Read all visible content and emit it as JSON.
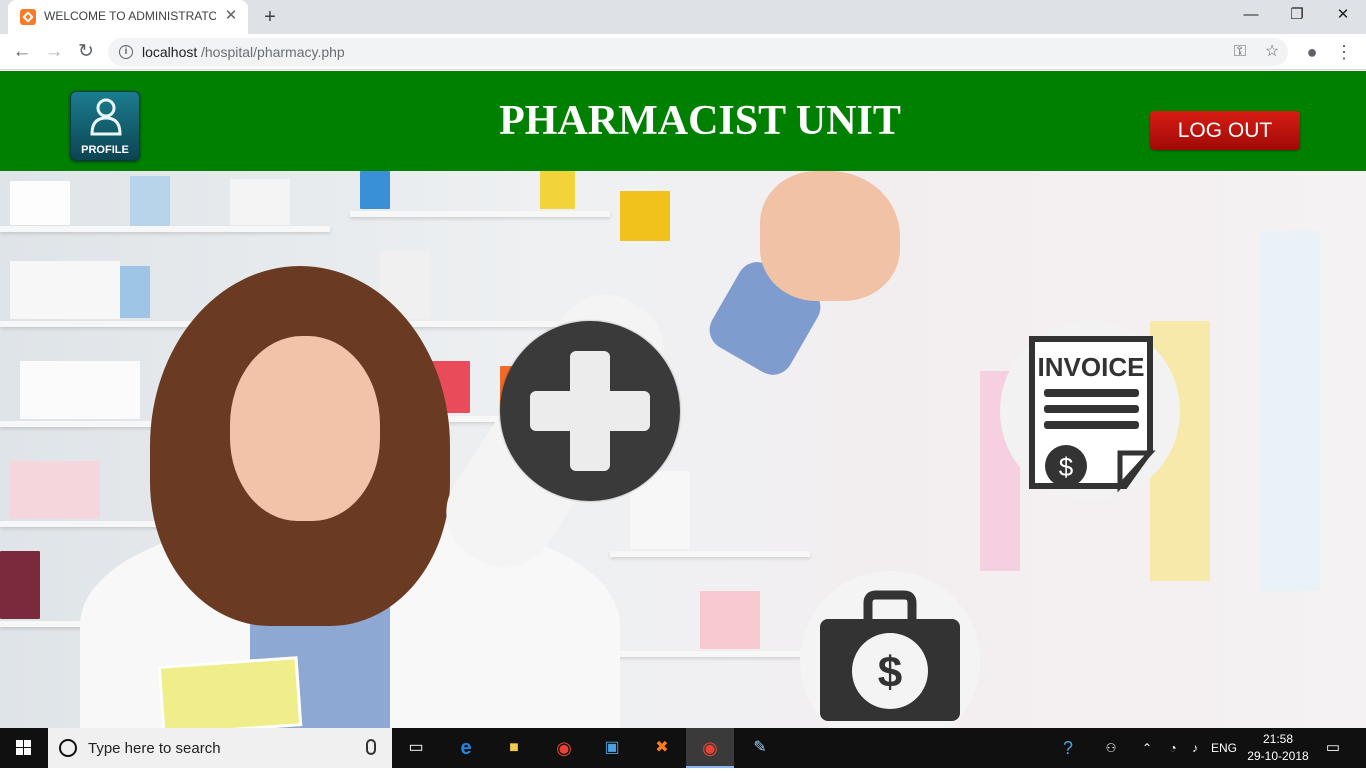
{
  "browser": {
    "tab_title": "WELCOME TO ADMINISTRATOR U",
    "tab_close": "✕",
    "new_tab": "+",
    "url_host": "localhost",
    "url_path": "/hospital/pharmacy.php",
    "window_controls": {
      "minimize": "—",
      "restore": "❐",
      "close": "✕"
    }
  },
  "header": {
    "profile_label": "PROFILE",
    "title": "PHARMACIST UNIT",
    "logout_label": "LOG OUT",
    "background_color": "#008000",
    "logout_color": "#c4120c"
  },
  "actions": [
    {
      "name": "medicine",
      "icon": "medical-cross-icon"
    },
    {
      "name": "invoice",
      "icon": "invoice-icon",
      "label": "INVOICE"
    },
    {
      "name": "payment",
      "icon": "money-bag-icon",
      "label": "$"
    }
  ],
  "taskbar": {
    "search_placeholder": "Type here to search",
    "language": "ENG",
    "time": "21:58",
    "date": "29-10-2018"
  }
}
